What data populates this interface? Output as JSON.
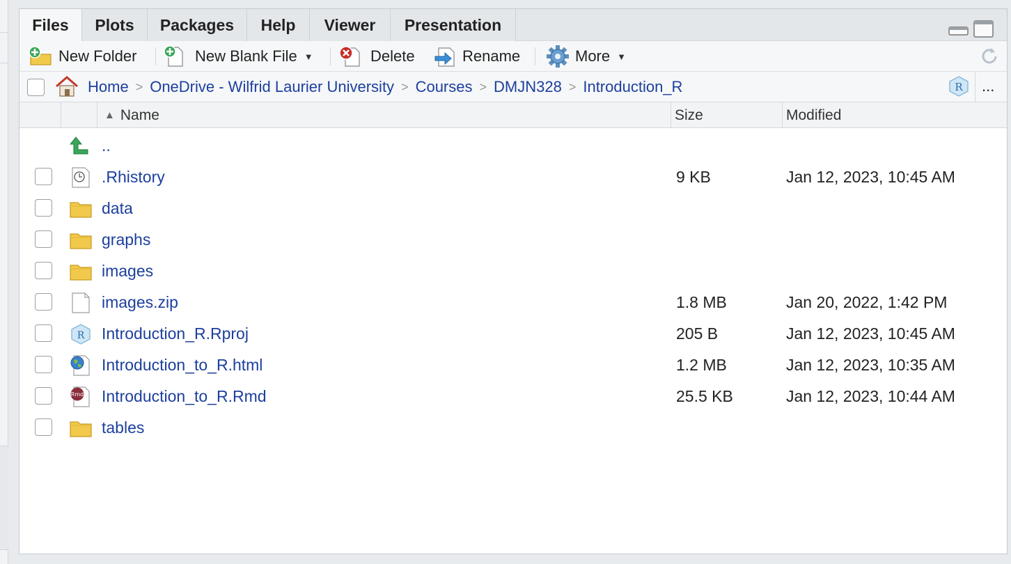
{
  "tabs": [
    {
      "label": "Files",
      "active": true
    },
    {
      "label": "Plots",
      "active": false
    },
    {
      "label": "Packages",
      "active": false
    },
    {
      "label": "Help",
      "active": false
    },
    {
      "label": "Viewer",
      "active": false
    },
    {
      "label": "Presentation",
      "active": false
    }
  ],
  "toolbar": {
    "new_folder": "New Folder",
    "new_blank_file": "New Blank File",
    "delete": "Delete",
    "rename": "Rename",
    "more": "More"
  },
  "breadcrumb": {
    "home": "Home",
    "items": [
      "OneDrive - Wilfrid Laurier University",
      "Courses",
      "DMJN328",
      "Introduction_R"
    ],
    "more": "..."
  },
  "columns": {
    "name": "Name",
    "size": "Size",
    "modified": "Modified"
  },
  "files": [
    {
      "name": "..",
      "size": "",
      "modified": "",
      "icon": "up-arrow-icon"
    },
    {
      "name": ".Rhistory",
      "size": "9 KB",
      "modified": "Jan 12, 2023, 10:45 AM",
      "icon": "history-file-icon"
    },
    {
      "name": "data",
      "size": "",
      "modified": "",
      "icon": "folder-icon"
    },
    {
      "name": "graphs",
      "size": "",
      "modified": "",
      "icon": "folder-icon"
    },
    {
      "name": "images",
      "size": "",
      "modified": "",
      "icon": "folder-icon"
    },
    {
      "name": "images.zip",
      "size": "1.8 MB",
      "modified": "Jan 20, 2022, 1:42 PM",
      "icon": "blank-file-icon"
    },
    {
      "name": "Introduction_R.Rproj",
      "size": "205 B",
      "modified": "Jan 12, 2023, 10:45 AM",
      "icon": "rproj-file-icon"
    },
    {
      "name": "Introduction_to_R.html",
      "size": "1.2 MB",
      "modified": "Jan 12, 2023, 10:35 AM",
      "icon": "html-file-icon"
    },
    {
      "name": "Introduction_to_R.Rmd",
      "size": "25.5 KB",
      "modified": "Jan 12, 2023, 10:44 AM",
      "icon": "rmd-file-icon"
    },
    {
      "name": "tables",
      "size": "",
      "modified": "",
      "icon": "folder-icon"
    }
  ],
  "icon_labels": {
    "rproj": "R",
    "rmd": "Rmd"
  },
  "colors": {
    "link": "#1c3f9e",
    "folder": "#f1c94b",
    "accent_green": "#3aa65a"
  }
}
